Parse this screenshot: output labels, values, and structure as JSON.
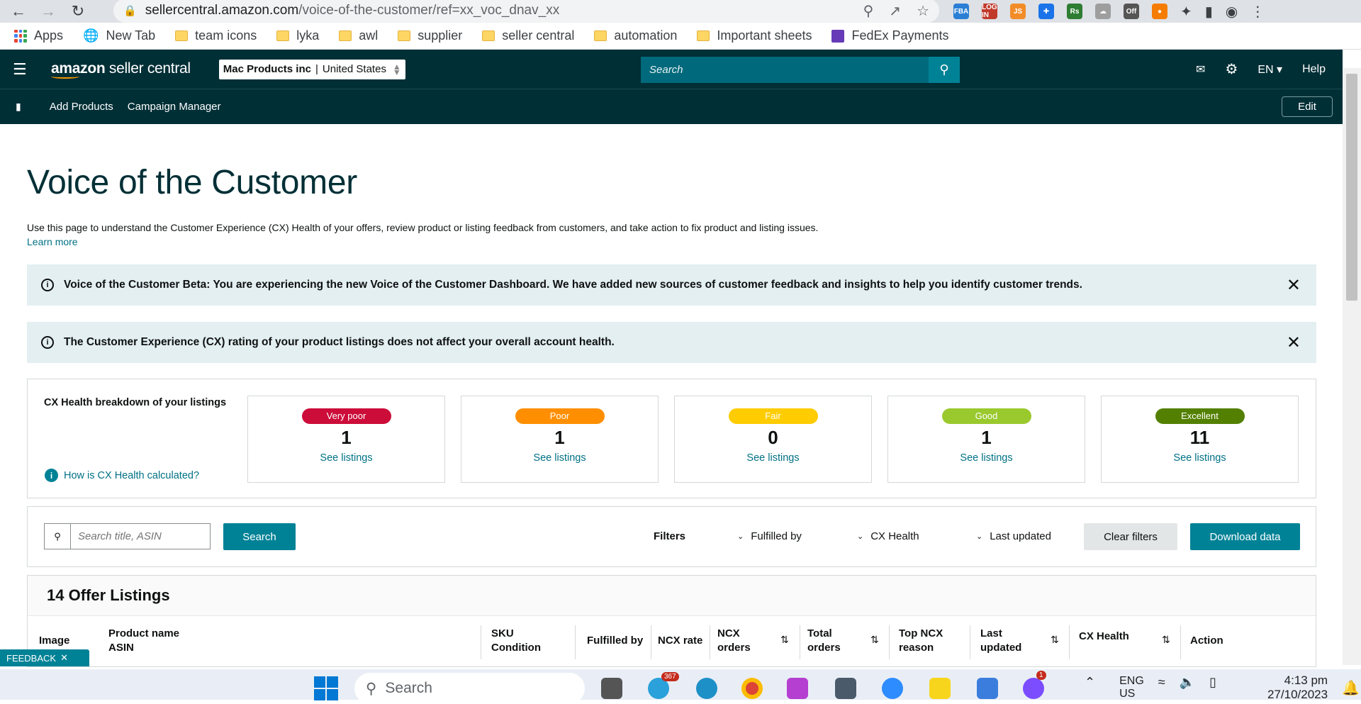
{
  "browser": {
    "url_domain": "sellercentral.amazon.com",
    "url_path": "/voice-of-the-customer/ref=xx_voc_dnav_xx",
    "extensions": [
      {
        "name": "fba-extension-icon",
        "label": "FBA",
        "color": "#2a7fd4"
      },
      {
        "name": "login-extension-icon",
        "label": "LOG IN",
        "color": "#c0392b"
      },
      {
        "name": "js-extension-icon",
        "label": "JS",
        "color": "#f28c28"
      },
      {
        "name": "compass-extension-icon",
        "label": "✚",
        "color": "#1a73e8"
      },
      {
        "name": "rs-extension-icon",
        "label": "Rs",
        "color": "#2e7d32"
      },
      {
        "name": "cloud-extension-icon",
        "label": "☁",
        "color": "#9e9e9e"
      },
      {
        "name": "off-extension-icon",
        "label": "Off",
        "color": "#555555"
      },
      {
        "name": "orange-extension-icon",
        "label": "●",
        "color": "#f57c00"
      }
    ],
    "off_badge": "Off"
  },
  "bookmarks": [
    {
      "label": "Apps",
      "type": "apps"
    },
    {
      "label": "New Tab",
      "type": "globe"
    },
    {
      "label": "team icons",
      "type": "folder"
    },
    {
      "label": "lyka",
      "type": "folder"
    },
    {
      "label": "awl",
      "type": "folder"
    },
    {
      "label": "supplier",
      "type": "folder"
    },
    {
      "label": "seller central",
      "type": "folder"
    },
    {
      "label": "automation",
      "type": "folder"
    },
    {
      "label": "Important sheets",
      "type": "folder"
    },
    {
      "label": "FedEx Payments",
      "type": "sheet"
    }
  ],
  "header": {
    "logo_bold": "amazon",
    "logo_light": " seller central",
    "account_name": "Mac Products inc",
    "account_sep": " | ",
    "account_region": "United States",
    "search_placeholder": "Search",
    "language": "EN",
    "help": "Help"
  },
  "nav": {
    "items": [
      "Add Products",
      "Campaign Manager"
    ],
    "edit": "Edit"
  },
  "page": {
    "title": "Voice of the Customer",
    "description": "Use this page to understand the Customer Experience (CX) Health of your offers, review product or listing feedback from customers, and take action to fix product and listing issues.",
    "learn_more": "Learn more",
    "alert1": "Voice of the Customer Beta: You are experiencing the new Voice of the Customer Dashboard. We have added new sources of customer feedback and insights to help you identify customer trends.",
    "alert2": "The Customer Experience (CX) rating of your product listings does not affect your overall account health."
  },
  "cx_health": {
    "title": "CX Health breakdown of your listings",
    "how": "How is CX Health calculated?",
    "see_listings": "See listings",
    "cards": [
      {
        "label": "Very poor",
        "count": "1",
        "color": "#cc0c39"
      },
      {
        "label": "Poor",
        "count": "1",
        "color": "#ff8f00"
      },
      {
        "label": "Fair",
        "count": "0",
        "color": "#ffcc00"
      },
      {
        "label": "Good",
        "count": "1",
        "color": "#9ac92e"
      },
      {
        "label": "Excellent",
        "count": "11",
        "color": "#538000"
      }
    ]
  },
  "filters": {
    "search_placeholder": "Search title, ASIN",
    "search_button": "Search",
    "filters_label": "Filters",
    "fulfilled_by": "Fulfilled by",
    "cx_health": "CX Health",
    "last_updated": "Last updated",
    "clear": "Clear filters",
    "download": "Download data"
  },
  "table": {
    "title": "14 Offer Listings",
    "headers": {
      "image": "Image",
      "product_name": "Product name",
      "asin": "ASIN",
      "sku": "SKU",
      "condition": "Condition",
      "fulfilled_by": "Fulfilled by",
      "ncx_rate": "NCX rate",
      "ncx_orders_1": "NCX",
      "ncx_orders_2": "orders",
      "total_orders_1": "Total",
      "total_orders_2": "orders",
      "top_ncx_1": "Top NCX",
      "top_ncx_2": "reason",
      "last_updated_1": "Last",
      "last_updated_2": "updated",
      "cx_health": "CX Health",
      "action": "Action"
    }
  },
  "feedback": "FEEDBACK",
  "taskbar": {
    "search": "Search",
    "telegram_badge": "367",
    "messenger_badge": "1",
    "lang1": "ENG",
    "lang2": "US",
    "time": "4:13 pm",
    "date": "27/10/2023"
  }
}
